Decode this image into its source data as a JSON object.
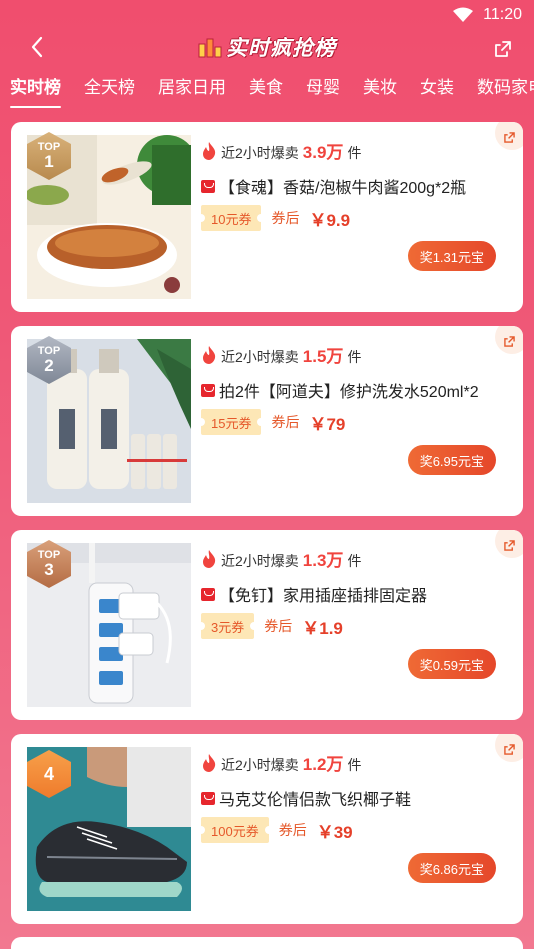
{
  "status": {
    "time": "11:20"
  },
  "header": {
    "title": "实时疯抢榜"
  },
  "tabs": [
    {
      "label": "实时榜",
      "active": true
    },
    {
      "label": "全天榜"
    },
    {
      "label": "居家日用"
    },
    {
      "label": "美食"
    },
    {
      "label": "母婴"
    },
    {
      "label": "美妆"
    },
    {
      "label": "女装"
    },
    {
      "label": "数码家电"
    }
  ],
  "products": [
    {
      "rank_top": "TOP",
      "rank": "1",
      "hot_prefix": "近2小时爆卖",
      "hot_count": "3.9万",
      "hot_unit": "件",
      "name": "【食魂】香菇/泡椒牛肉酱200g*2瓶",
      "coupon": "10元券",
      "after_label": "券后",
      "price": "￥9.9",
      "reward": "奖1.31元宝"
    },
    {
      "rank_top": "TOP",
      "rank": "2",
      "hot_prefix": "近2小时爆卖",
      "hot_count": "1.5万",
      "hot_unit": "件",
      "name": "拍2件【阿道夫】修护洗发水520ml*2",
      "coupon": "15元券",
      "after_label": "券后",
      "price": "￥79",
      "reward": "奖6.95元宝"
    },
    {
      "rank_top": "TOP",
      "rank": "3",
      "hot_prefix": "近2小时爆卖",
      "hot_count": "1.3万",
      "hot_unit": "件",
      "name": "【免钉】家用插座插排固定器",
      "coupon": "3元券",
      "after_label": "券后",
      "price": "￥1.9",
      "reward": "奖0.59元宝"
    },
    {
      "rank_top": "",
      "rank": "4",
      "hot_prefix": "近2小时爆卖",
      "hot_count": "1.2万",
      "hot_unit": "件",
      "name": "马克艾伦情侣款飞织椰子鞋",
      "coupon": "100元券",
      "after_label": "券后",
      "price": "￥39",
      "reward": "奖6.86元宝"
    }
  ],
  "colors": {
    "accent": "#f04e6e",
    "price": "#e5402a",
    "coupon_bg": "#fde7b6"
  }
}
